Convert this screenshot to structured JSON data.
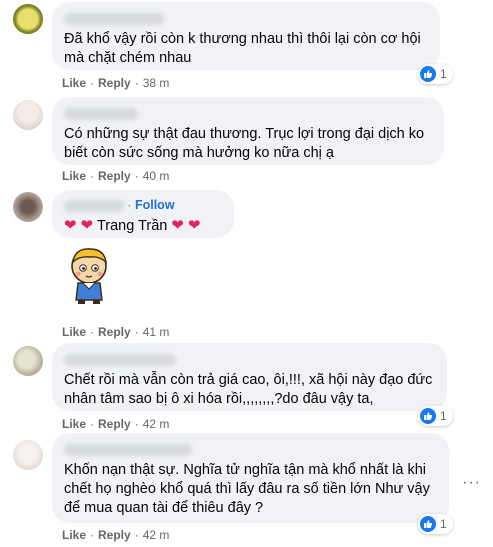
{
  "actions": {
    "like": "Like",
    "reply": "Reply",
    "separator": "·"
  },
  "comments": [
    {
      "text": "Đã khổ vậy rồi còn k thương nhau thì thôi lại còn cơ hội mà chặt chém nhau",
      "time": "38 m",
      "reactions": "1"
    },
    {
      "text": "Có những sự thật đau thương. Trục lợi trong đại dịch ko biết còn sức sống mà hưởng ko nữa chị ạ",
      "time": "40 m",
      "reactions": ""
    },
    {
      "follow": "Follow",
      "tag_name": "Trang Trần",
      "time": "41 m"
    },
    {
      "text": "Chết rồi mà vẫn còn trả giá cao, ôi,!!!, xã hội này đạo đức nhân tâm sao bị ô xi hóa rồi,,,,,,,,?do đâu vậy ta,",
      "time": "42 m",
      "reactions": "1"
    },
    {
      "text": "Khốn nạn thật sự. Nghĩa tử nghĩa tận mà khổ nhất là khi chết họ nghèo khổ quá thì lấy đâu ra số tiền lớn Như vậy để mua quan tài để thiêu đây ?",
      "time": "42 m",
      "reactions": "1",
      "more": "···"
    }
  ],
  "colors": {
    "bubble": "#f0f2f5",
    "meta": "#65676b",
    "like_blue": "#1877f2",
    "follow": "#216fdb",
    "heart": "#e0245e"
  }
}
